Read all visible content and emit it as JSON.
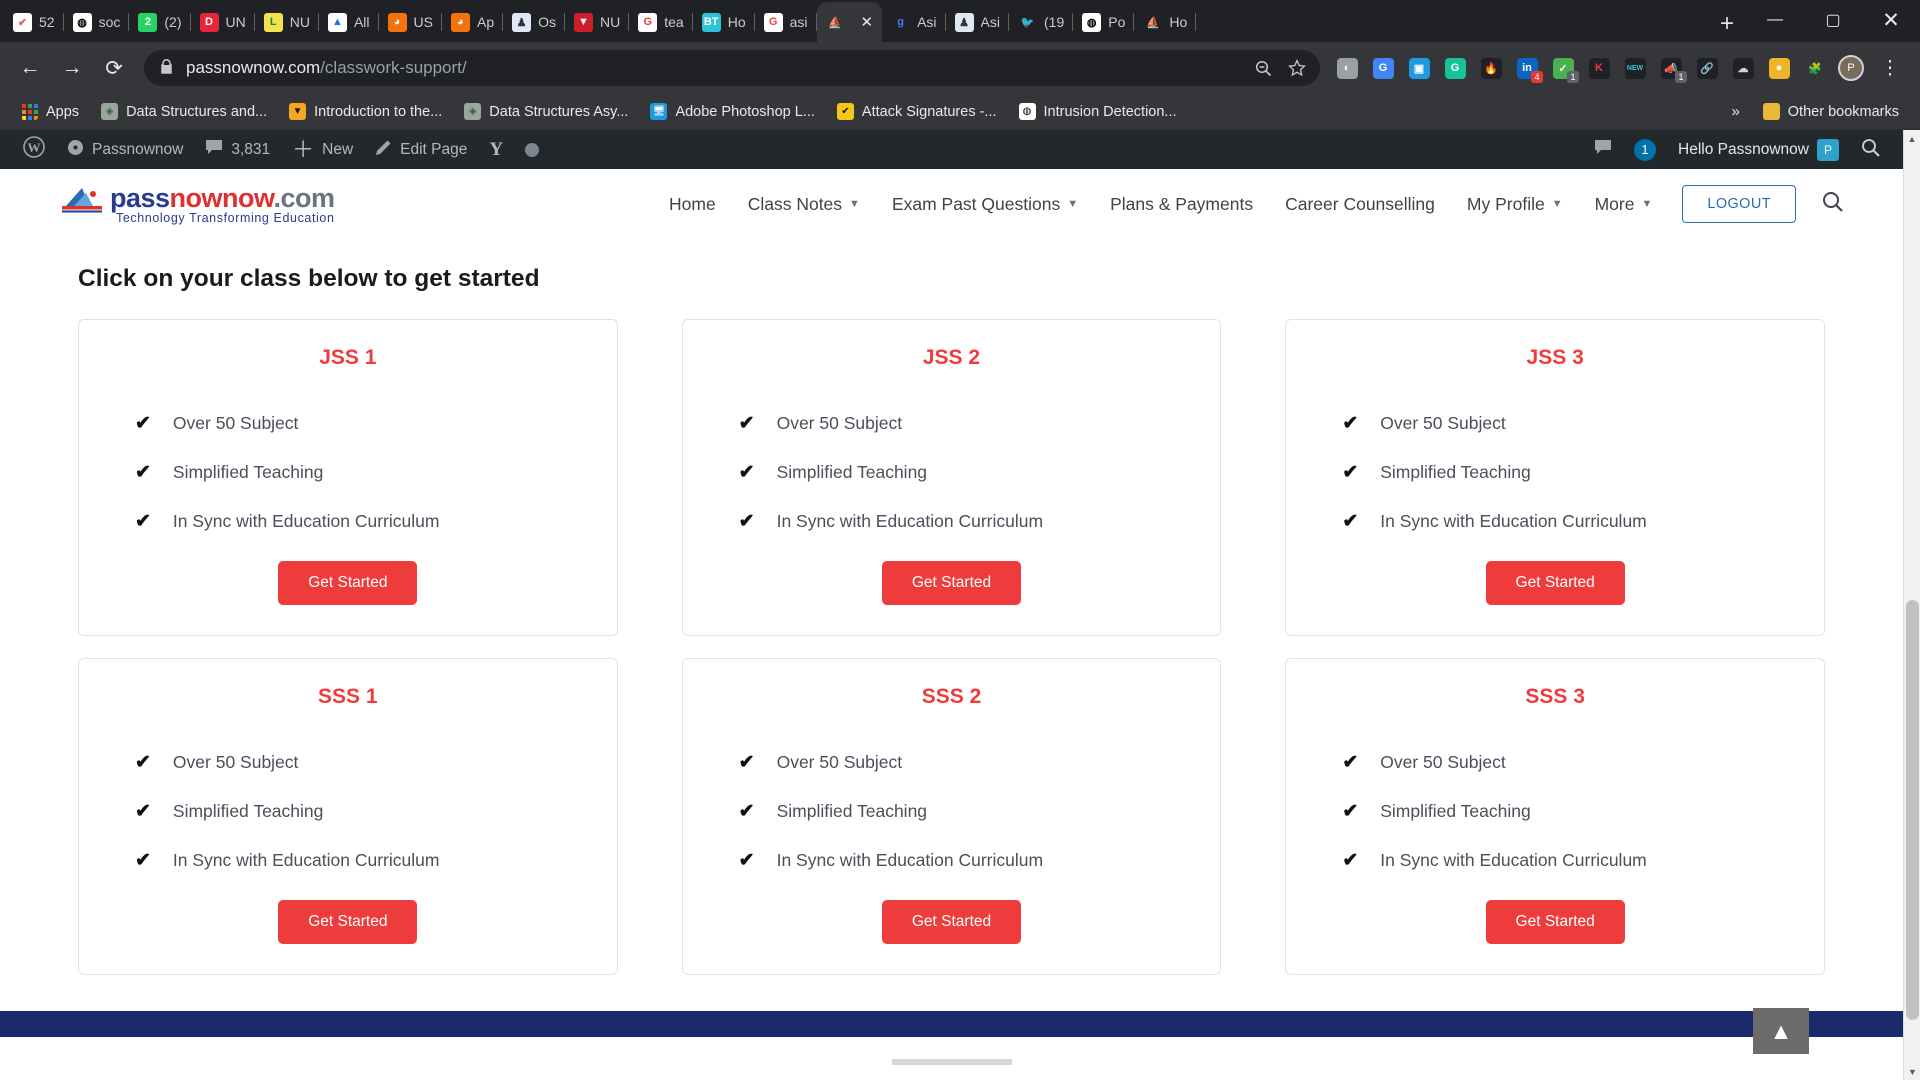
{
  "browser": {
    "tabs": [
      {
        "label": "52",
        "icon": "checkmark-circle-icon",
        "fav_bg": "#ffffff",
        "fav_fg": "#d9685f",
        "glyph": "✔"
      },
      {
        "label": "soc",
        "icon": "globe-icon",
        "fav_bg": "#ffffff",
        "fav_fg": "#000000",
        "glyph": "◍"
      },
      {
        "label": "(2)",
        "icon": "whatsapp-icon",
        "fav_bg": "#25d366",
        "fav_fg": "#ffffff",
        "glyph": "2"
      },
      {
        "label": "UN",
        "icon": "d-letter-icon",
        "fav_bg": "#e8253a",
        "fav_fg": "#ffffff",
        "glyph": "D"
      },
      {
        "label": "NU",
        "icon": "l-letter-icon",
        "fav_bg": "#f2e34c",
        "fav_fg": "#1a7f5a",
        "glyph": "L"
      },
      {
        "label": "All",
        "icon": "google-drive-icon",
        "fav_bg": "#ffffff",
        "fav_fg": "#1a73e8",
        "glyph": "▲"
      },
      {
        "label": "US",
        "icon": "graduate-icon",
        "fav_bg": "#f4730c",
        "fav_fg": "#ffffff",
        "glyph": "◕"
      },
      {
        "label": "Ap",
        "icon": "graduate-icon",
        "fav_bg": "#f4730c",
        "fav_fg": "#ffffff",
        "glyph": "◕"
      },
      {
        "label": "Os",
        "icon": "torch-icon",
        "fav_bg": "#dfe9f5",
        "fav_fg": "#333333",
        "glyph": "♟"
      },
      {
        "label": "NU",
        "icon": "shield-red-icon",
        "fav_bg": "#cc1f2a",
        "fav_fg": "#ffffff",
        "glyph": "▼"
      },
      {
        "label": "tea",
        "icon": "google-icon",
        "fav_bg": "#ffffff",
        "fav_fg": "#ea4335",
        "glyph": "G"
      },
      {
        "label": "Ho",
        "icon": "bt-tools-icon",
        "fav_bg": "#2ec4d8",
        "fav_fg": "#ffffff",
        "glyph": "BT"
      },
      {
        "label": "asi",
        "icon": "google-icon",
        "fav_bg": "#ffffff",
        "fav_fg": "#ea4335",
        "glyph": "G"
      },
      {
        "label": "",
        "icon": "passnownow-icon",
        "fav_bg": "#35363a",
        "fav_fg": "#cfd3d8",
        "glyph": "⛵",
        "active": true,
        "close": "✕"
      },
      {
        "label": "Asi",
        "icon": "g-letter-icon",
        "fav_bg": "#202124",
        "fav_fg": "#3b82f6",
        "glyph": "g"
      },
      {
        "label": "Asi",
        "icon": "torch-icon",
        "fav_bg": "#dfe9f5",
        "fav_fg": "#333333",
        "glyph": "♟"
      },
      {
        "label": "(19",
        "icon": "twitter-icon",
        "fav_bg": "#202124",
        "fav_fg": "#1da1f2",
        "glyph": "🐦"
      },
      {
        "label": "Po",
        "icon": "globe-icon",
        "fav_bg": "#ffffff",
        "fav_fg": "#000000",
        "glyph": "◍"
      },
      {
        "label": "Ho",
        "icon": "passnownow-icon",
        "fav_bg": "#202124",
        "fav_fg": "#cfd3d8",
        "glyph": "⛵"
      }
    ],
    "new_tab_label": "+",
    "window_controls": {
      "minimize": "—",
      "maximize": "▢",
      "close": "✕"
    },
    "nav": {
      "back": "←",
      "forward": "→",
      "reload": "⟳"
    },
    "address": {
      "lock_icon": "lock-icon",
      "domain": "passnownow.com",
      "path": "/classwork-support/",
      "zoom_icon": "zoom-out-icon",
      "bookmark_icon": "star-icon"
    },
    "extensions": [
      {
        "name": "bulb-extension",
        "bg": "#9aa0a6",
        "fg": "#ffffff",
        "glyph": "◐"
      },
      {
        "name": "google-translate-extension",
        "bg": "#4285f4",
        "fg": "#ffffff",
        "glyph": "G"
      },
      {
        "name": "screenshot-extension",
        "bg": "#1f9ae0",
        "fg": "#ffffff",
        "glyph": "▣"
      },
      {
        "name": "grammarly-extension",
        "bg": "#15c39a",
        "fg": "#ffffff",
        "glyph": "G"
      },
      {
        "name": "fire-extension",
        "bg": "#202124",
        "fg": "#ff7043",
        "glyph": "🔥"
      },
      {
        "name": "linkedin-extension",
        "bg": "#0a66c2",
        "fg": "#ffffff",
        "glyph": "in",
        "badge": "4"
      },
      {
        "name": "adblock-shield-extension",
        "bg": "#4caf50",
        "fg": "#ffffff",
        "glyph": "✓",
        "badge": "1",
        "badge_gray": true
      },
      {
        "name": "kaspersky-extension",
        "bg": "#202124",
        "fg": "#e8384f",
        "glyph": "K"
      },
      {
        "name": "new-ai-extension",
        "bg": "#202124",
        "fg": "#2ec4d8",
        "glyph": "NEW"
      },
      {
        "name": "megaphone-extension",
        "bg": "#202124",
        "fg": "#e8602c",
        "glyph": "📣",
        "badge": "1",
        "badge_gray": true
      },
      {
        "name": "link-extension",
        "bg": "#202124",
        "fg": "#3b5bdb",
        "glyph": "🔗"
      },
      {
        "name": "cloud-extension",
        "bg": "#202124",
        "fg": "#cfd3d8",
        "glyph": "☁"
      },
      {
        "name": "coin-extension",
        "bg": "#f0b429",
        "fg": "#ffffff",
        "glyph": "●"
      },
      {
        "name": "puzzle-extensions-icon",
        "bg": "#35363a",
        "fg": "#dfe1e5",
        "glyph": "🧩"
      }
    ],
    "profile_initial": "P",
    "menu_icon": "three-dot-menu-icon",
    "bookmarks": [
      {
        "label": "Apps",
        "icon": "apps-grid-icon"
      },
      {
        "label": "Data Structures and...",
        "icon": "diamond-site-icon",
        "bg": "#9aa69c",
        "fg": "#2f5f3f",
        "glyph": "◈"
      },
      {
        "label": "Introduction to the...",
        "icon": "bee-site-icon",
        "bg": "#f5a623",
        "fg": "#1a1a1a",
        "glyph": "▼"
      },
      {
        "label": "Data Structures Asy...",
        "icon": "diamond-site-icon",
        "bg": "#9aa69c",
        "fg": "#2f5f3f",
        "glyph": "◈"
      },
      {
        "label": "Adobe Photoshop L...",
        "icon": "monitor-icon",
        "bg": "#1f9ae0",
        "fg": "#ffffff",
        "glyph": "🖥"
      },
      {
        "label": "Attack Signatures -...",
        "icon": "norton-icon",
        "bg": "#f5c518",
        "fg": "#111111",
        "glyph": "✔"
      },
      {
        "label": "Intrusion Detection...",
        "icon": "globe-icon",
        "bg": "#ffffff",
        "fg": "#000000",
        "glyph": "◍"
      }
    ],
    "overflow_label": "»",
    "other_bookmarks": {
      "label": "Other bookmarks",
      "icon": "folder-icon"
    }
  },
  "wp_admin_bar": {
    "logo_icon": "wordpress-logo-icon",
    "site_icon": "dashboard-icon",
    "site_name": "Passnownow",
    "comments_icon": "comment-bubble-icon",
    "comments_count": "3,831",
    "new_icon": "plus-icon",
    "new_label": "New",
    "edit_icon": "pencil-icon",
    "edit_label": "Edit Page",
    "yoast_icon": "yoast-seo-icon",
    "status_dot": "status-dot-icon",
    "right_comment_icon": "comment-bubble-icon",
    "notification_count": "1",
    "greeting": "Hello Passnownow",
    "avatar_initial": "P",
    "search_icon": "search-icon"
  },
  "site": {
    "logo": {
      "text_pass": "pass",
      "text_nownow": "nownow",
      "text_dotcom": ".com",
      "tagline": "Technology Transforming Education"
    },
    "nav": [
      {
        "label": "Home",
        "caret": false
      },
      {
        "label": "Class Notes",
        "caret": true
      },
      {
        "label": "Exam Past Questions",
        "caret": true
      },
      {
        "label": "Plans & Payments",
        "caret": false
      },
      {
        "label": "Career Counselling",
        "caret": false
      },
      {
        "label": "My Profile",
        "caret": true
      },
      {
        "label": "More",
        "caret": true
      }
    ],
    "logout_label": "LOGOUT",
    "search_icon": "search-icon"
  },
  "main": {
    "heading": "Click on your class below to get started",
    "feature_tick": "✔",
    "cta_label": "Get Started",
    "accent_color": "#ee3b3b",
    "cards": [
      {
        "title": "JSS 1",
        "features": [
          "Over 50 Subject",
          "Simplified Teaching",
          "In Sync with Education Curriculum"
        ]
      },
      {
        "title": "JSS 2",
        "features": [
          "Over 50 Subject",
          "Simplified Teaching",
          "In Sync with Education Curriculum"
        ]
      },
      {
        "title": "JSS 3",
        "features": [
          "Over 50 Subject",
          "Simplified Teaching",
          "In Sync with Education Curriculum"
        ]
      },
      {
        "title": "SSS 1",
        "features": [
          "Over 50 Subject",
          "Simplified Teaching",
          "In Sync with Education Curriculum"
        ]
      },
      {
        "title": "SSS 2",
        "features": [
          "Over 50 Subject",
          "Simplified Teaching",
          "In Sync with Education Curriculum"
        ]
      },
      {
        "title": "SSS 3",
        "features": [
          "Over 50 Subject",
          "Simplified Teaching",
          "In Sync with Education Curriculum"
        ]
      }
    ],
    "scroll_top_icon": "chevron-up-icon",
    "scroll_top_glyph": "▲"
  },
  "scrollbar": {
    "up_glyph": "▲",
    "down_glyph": "▼"
  }
}
